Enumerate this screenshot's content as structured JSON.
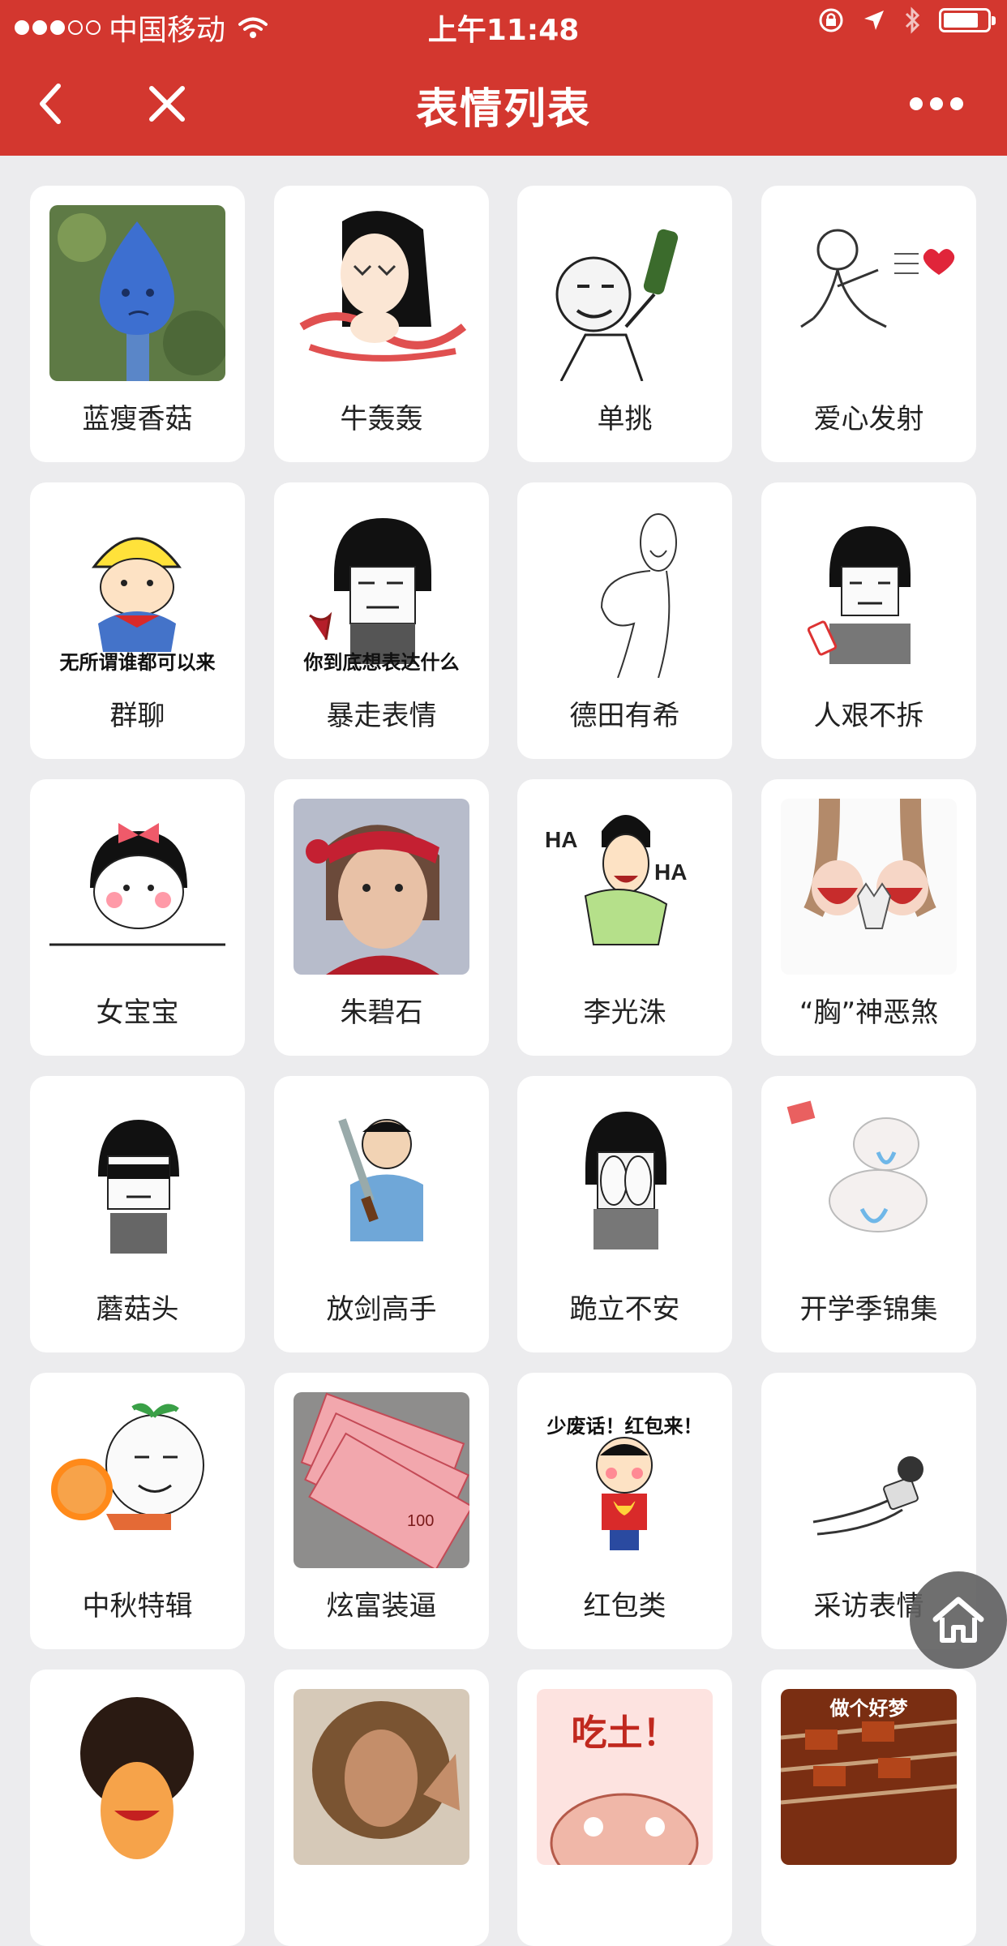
{
  "status_bar": {
    "carrier": "中国移动",
    "time": "上午11:48",
    "signal_strength": 3,
    "battery_level": 0.8
  },
  "nav": {
    "title": "表情列表",
    "back_icon": "chevron-left-icon",
    "close_icon": "close-icon",
    "more_icon": "more-dots-icon"
  },
  "items": [
    {
      "label": "蓝瘦香菇",
      "image": "blue-mushroom-face"
    },
    {
      "label": "牛轰轰",
      "image": "cartoon-girl-long-hair"
    },
    {
      "label": "单挑",
      "image": "rage-face-holding-bottle"
    },
    {
      "label": "爱心发射",
      "image": "stick-figure-shooting-heart"
    },
    {
      "label": "群聊",
      "image": "cartoon-boy-yellow-helmet",
      "image_text": "无所谓谁都可以来"
    },
    {
      "label": "暴走表情",
      "image": "bowl-cut-face-wine",
      "image_text": "你到底想表达什么"
    },
    {
      "label": "德田有希",
      "image": "line-drawing-smiling-figure"
    },
    {
      "label": "人艰不拆",
      "image": "bowl-cut-face-phone"
    },
    {
      "label": "女宝宝",
      "image": "cartoon-girl-red-bow"
    },
    {
      "label": "朱碧石",
      "image": "man-with-red-headband"
    },
    {
      "label": "李光洙",
      "image": "laughing-man-ha-ha"
    },
    {
      "label": "“胸”神恶煞",
      "image": "cat-in-bikini-top"
    },
    {
      "label": "蘑菇头",
      "image": "bowl-cut-face-sunglasses"
    },
    {
      "label": "放剑高手",
      "image": "man-holding-knife"
    },
    {
      "label": "跪立不安",
      "image": "bowl-cut-face-hands-covered"
    },
    {
      "label": "开学季锦集",
      "image": "crying-cartoon-babies"
    },
    {
      "label": "中秋特辑",
      "image": "bun-face-with-mooncake"
    },
    {
      "label": "炫富装逼",
      "image": "stack-of-banknotes"
    },
    {
      "label": "红包类",
      "image": "boy-holding-red-envelope",
      "image_text": "少废话！红包来！"
    },
    {
      "label": "采访表情",
      "image": "hand-holding-microphone"
    },
    {
      "label": "",
      "image": "afro-cartoon-face"
    },
    {
      "label": "",
      "image": "woman-with-curly-hair"
    },
    {
      "label": "",
      "image": "eat-dirt-cartoon",
      "image_text": "吃土！"
    },
    {
      "label": "",
      "image": "barbecue-skewers",
      "image_text": "做个好梦"
    }
  ],
  "home_button": {
    "icon": "home-icon"
  }
}
